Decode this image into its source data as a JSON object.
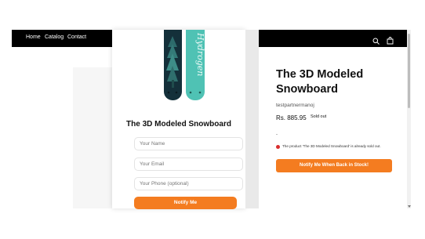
{
  "left_nav": {
    "items": [
      "Home",
      "Catalog",
      "Contact"
    ]
  },
  "modal": {
    "title": "The 3D Modeled Snowboard",
    "fields": {
      "name_placeholder": "Your Name",
      "email_placeholder": "Your Email",
      "phone_placeholder": "Your Phone (optional)"
    },
    "button_label": "Notify Me",
    "board_text": "Hydrogen"
  },
  "product": {
    "title": "The 3D Modeled Snowboard",
    "vendor": "testpartnermanoj",
    "price": "Rs. 885.95",
    "sold_out_label": "Sold out",
    "dot": "-",
    "notice": "The product 'The 3D Modeled Snowboard' is already sold out.",
    "back_in_stock_label": "Notify Me When Back in Stock!"
  },
  "header_icons": [
    "search-icon",
    "cart-icon"
  ],
  "colors": {
    "accent": "#f47c20",
    "nav_bg": "#000000",
    "warning": "#d92d2d",
    "board_dark": "#14303a",
    "board_teal": "#4fc2b4"
  }
}
